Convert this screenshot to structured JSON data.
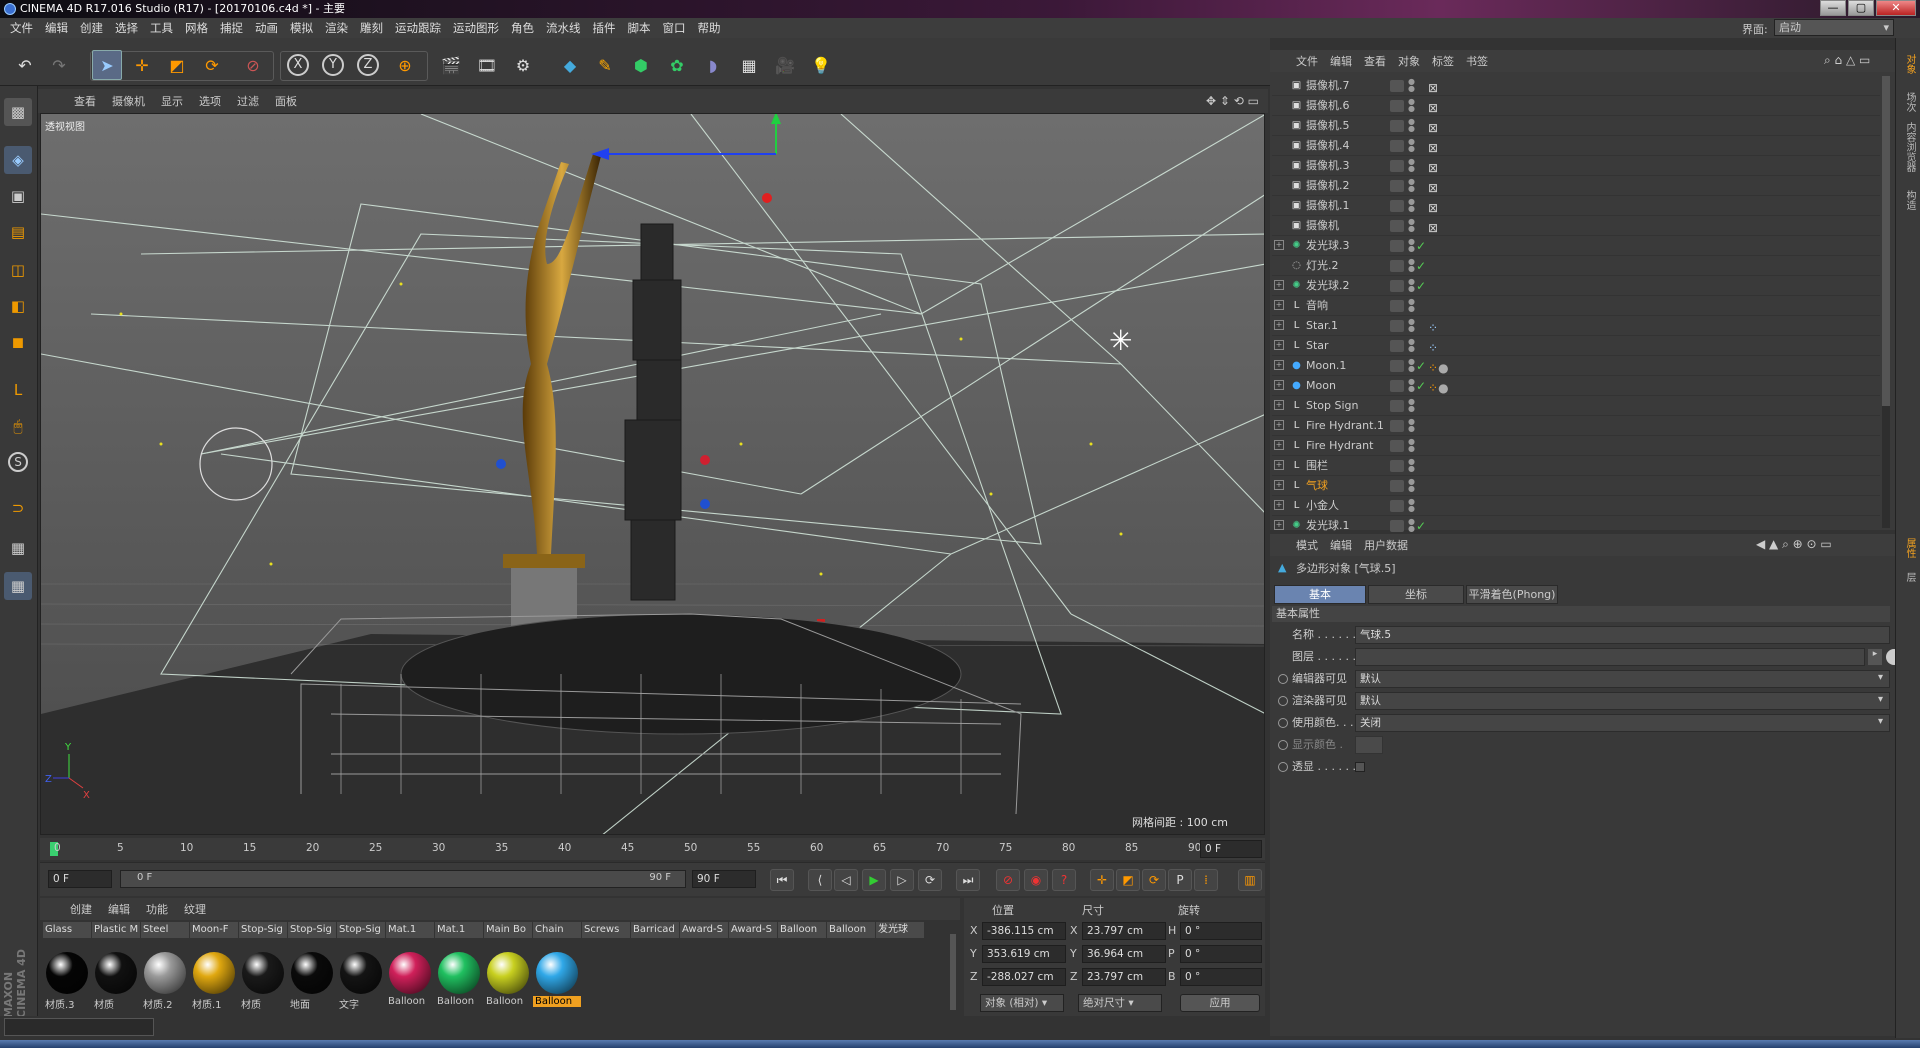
{
  "window": {
    "title": "CINEMA 4D R17.016 Studio (R17) - [20170106.c4d *] - 主要",
    "controls": [
      "—",
      "▢",
      "✕"
    ]
  },
  "menu": [
    "文件",
    "编辑",
    "创建",
    "选择",
    "工具",
    "网格",
    "捕捉",
    "动画",
    "模拟",
    "渲染",
    "雕刻",
    "运动跟踪",
    "运动图形",
    "角色",
    "流水线",
    "插件",
    "脚本",
    "窗口",
    "帮助"
  ],
  "layout": {
    "label": "界面:",
    "value": "启动"
  },
  "viewport": {
    "menu": [
      "查看",
      "摄像机",
      "显示",
      "选项",
      "过滤",
      "面板"
    ],
    "label": "透视视图",
    "grid": "网格间距 : 100 cm",
    "axes": {
      "y": "Y",
      "z": "Z",
      "x": "X"
    }
  },
  "timeline": {
    "ticks": [
      "0",
      "5",
      "10",
      "15",
      "20",
      "25",
      "30",
      "35",
      "40",
      "45",
      "50",
      "55",
      "60",
      "65",
      "70",
      "75",
      "80",
      "85",
      "90"
    ],
    "current": "0 F",
    "start": "0 F",
    "slider_left": "0 F",
    "slider_right": "90 F",
    "end": "90 F"
  },
  "materials": {
    "menu": [
      "创建",
      "编辑",
      "功能",
      "纹理"
    ],
    "items": [
      {
        "name": "Glass",
        "label": "材质.3",
        "color": "#050505",
        "hl": false
      },
      {
        "name": "Plastic M",
        "label": "材质",
        "color": "#111111",
        "hl": false
      },
      {
        "name": "Steel",
        "label": "材质.2",
        "color": "#9a9a9a",
        "hl": false
      },
      {
        "name": "Moon-F",
        "label": "材质.1",
        "color": "#e0a810",
        "hl": false
      },
      {
        "name": "Stop-Sig",
        "label": "材质",
        "color": "#1a1a1a",
        "hl": false
      },
      {
        "name": "Stop-Sig",
        "label": "地面",
        "color": "#0a0a0a",
        "hl": false
      },
      {
        "name": "Stop-Sig",
        "label": "文字",
        "color": "#141414",
        "hl": false
      },
      {
        "name": "Mat.1",
        "label": "Balloon",
        "color": "#d0205a",
        "hl": false
      },
      {
        "name": "Mat.1",
        "label": "Balloon",
        "color": "#20c060",
        "hl": false
      },
      {
        "name": "Main Bo",
        "label": "Balloon",
        "color": "#c8d020",
        "hl": false
      },
      {
        "name": "Chain",
        "label": "Balloon",
        "color": "#30a8e8",
        "hl": true
      },
      {
        "name": "Screws",
        "label": "",
        "color": "",
        "hl": false
      },
      {
        "name": "Barricad",
        "label": "",
        "color": "",
        "hl": false
      },
      {
        "name": "Award-S",
        "label": "",
        "color": "",
        "hl": false
      },
      {
        "name": "Award-S",
        "label": "",
        "color": "",
        "hl": false
      },
      {
        "name": "Balloon",
        "label": "",
        "color": "",
        "hl": false
      },
      {
        "name": "Balloon",
        "label": "",
        "color": "",
        "hl": false
      },
      {
        "name": "发光球",
        "label": "",
        "color": "",
        "hl": false
      }
    ]
  },
  "coords": {
    "headers": [
      "位置",
      "尺寸",
      "旋转"
    ],
    "rows": [
      {
        "axis": "X",
        "pos": "-386.115 cm",
        "sizeaxis": "X",
        "size": "23.797 cm",
        "rotaxis": "H",
        "rot": "0 °"
      },
      {
        "axis": "Y",
        "pos": "353.619 cm",
        "sizeaxis": "Y",
        "size": "36.964 cm",
        "rotaxis": "P",
        "rot": "0 °"
      },
      {
        "axis": "Z",
        "pos": "-288.027 cm",
        "sizeaxis": "Z",
        "size": "23.797 cm",
        "rotaxis": "B",
        "rot": "0 °"
      }
    ],
    "mode": "对象 (相对)",
    "sizemode": "绝对尺寸",
    "apply": "应用"
  },
  "objects": {
    "menu": [
      "文件",
      "编辑",
      "查看",
      "对象",
      "标签",
      "书签"
    ],
    "rows": [
      {
        "name": "摄像机.7",
        "icon": "camera-icon",
        "color": "#ccc",
        "check": "",
        "tree": ""
      },
      {
        "name": "摄像机.6",
        "icon": "camera-icon",
        "color": "#ccc",
        "check": "",
        "tree": ""
      },
      {
        "name": "摄像机.5",
        "icon": "camera-icon",
        "color": "#ccc",
        "check": "",
        "tree": ""
      },
      {
        "name": "摄像机.4",
        "icon": "camera-icon",
        "color": "#ccc",
        "check": "",
        "tree": ""
      },
      {
        "name": "摄像机.3",
        "icon": "camera-icon",
        "color": "#ccc",
        "check": "",
        "tree": ""
      },
      {
        "name": "摄像机.2",
        "icon": "camera-icon",
        "color": "#ccc",
        "check": "",
        "tree": ""
      },
      {
        "name": "摄像机.1",
        "icon": "camera-icon",
        "color": "#ccc",
        "check": "",
        "tree": ""
      },
      {
        "name": "摄像机",
        "icon": "camera-icon",
        "color": "#ccc",
        "check": "",
        "tree": ""
      },
      {
        "name": "发光球.3",
        "icon": "emitter-icon",
        "color": "#ccc",
        "check": "✓",
        "tree": "+"
      },
      {
        "name": "灯光.2",
        "icon": "light-icon",
        "color": "#ccc",
        "check": "✓",
        "tree": ""
      },
      {
        "name": "发光球.2",
        "icon": "emitter-icon",
        "color": "#ccc",
        "check": "✓",
        "tree": "+"
      },
      {
        "name": "音响",
        "icon": "null-icon",
        "color": "#ccc",
        "check": "",
        "tree": "+"
      },
      {
        "name": "Star.1",
        "icon": "null-icon",
        "color": "#ccc",
        "check": "",
        "tree": "+"
      },
      {
        "name": "Star",
        "icon": "null-icon",
        "color": "#ccc",
        "check": "",
        "tree": "+"
      },
      {
        "name": "Moon.1",
        "icon": "sphere-icon",
        "color": "#ccc",
        "check": "✓",
        "tree": "+"
      },
      {
        "name": "Moon",
        "icon": "sphere-icon",
        "color": "#ccc",
        "check": "✓",
        "tree": "+"
      },
      {
        "name": "Stop Sign",
        "icon": "null-icon",
        "color": "#ccc",
        "check": "",
        "tree": "+"
      },
      {
        "name": "Fire Hydrant.1",
        "icon": "null-icon",
        "color": "#ccc",
        "check": "",
        "tree": "+"
      },
      {
        "name": "Fire Hydrant",
        "icon": "null-icon",
        "color": "#ccc",
        "check": "",
        "tree": "+"
      },
      {
        "name": "围栏",
        "icon": "null-icon",
        "color": "#ccc",
        "check": "",
        "tree": "+"
      },
      {
        "name": "气球",
        "icon": "null-icon",
        "color": "#f0a020",
        "check": "",
        "tree": "+"
      },
      {
        "name": "小金人",
        "icon": "null-icon",
        "color": "#ccc",
        "check": "",
        "tree": "+"
      },
      {
        "name": "发光球.1",
        "icon": "emitter-icon",
        "color": "#ccc",
        "check": "✓",
        "tree": "+"
      }
    ]
  },
  "attributes": {
    "menu": [
      "模式",
      "编辑",
      "用户数据"
    ],
    "object_title": "多边形对象 [气球.5]",
    "tabs": [
      "基本",
      "坐标",
      "平滑着色(Phong)"
    ],
    "section": "基本属性",
    "rows": [
      {
        "label": "名称 . . . . . .",
        "value": "气球.5"
      },
      {
        "label": "图层 . . . . . .",
        "value": ""
      },
      {
        "label": "编辑器可见",
        "value": "默认"
      },
      {
        "label": "渲染器可见",
        "value": "默认"
      },
      {
        "label": "使用颜色. . . .",
        "value": "关闭"
      },
      {
        "label": "显示颜色 .",
        "value": ""
      },
      {
        "label": "透显 . . . . . .",
        "value": ""
      }
    ]
  },
  "rightTabs": [
    "对象",
    "场次",
    "内容浏览器",
    "构造"
  ],
  "rightTabs2": [
    "属性",
    "层"
  ],
  "brand": "MAXON CINEMA 4D",
  "colors": {
    "accent": "#6a84b0",
    "highlight": "#f0a020",
    "bg": "#3a3a3a"
  }
}
